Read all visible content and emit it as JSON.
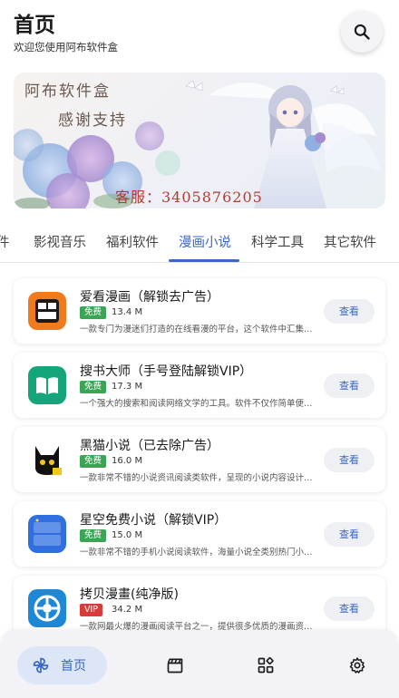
{
  "header": {
    "title": "首页",
    "subtitle": "欢迎您使用阿布软件盒",
    "search_icon": "search-icon"
  },
  "banner": {
    "line1": "阿布软件盒",
    "line2": "感谢支持",
    "line3": "客服：3405876205"
  },
  "tabs": [
    {
      "label": "件"
    },
    {
      "label": "影视音乐"
    },
    {
      "label": "福利软件"
    },
    {
      "label": "漫画小说",
      "active": true
    },
    {
      "label": "科学工具"
    },
    {
      "label": "其它软件"
    }
  ],
  "apps": [
    {
      "name": "爱看漫画（解锁去广告）",
      "badge": "免费",
      "size": "13.4 M",
      "desc": "一款专门为漫迷们打造的在线看漫的平台，这个软件中汇集…",
      "button": "查看",
      "icon": "comic-app-icon"
    },
    {
      "name": "搜书大师（手号登陆解锁VIP）",
      "badge": "免费",
      "size": "17.3 M",
      "desc": "一个强大的搜索和阅读网络文学的工具。软件不仅作简单便…",
      "button": "查看",
      "icon": "book-app-icon"
    },
    {
      "name": "黑猫小说（已去除广告）",
      "badge": "免费",
      "size": "16.0 M",
      "desc": "一款非常不错的小说资讯阅读类软件，呈现的小说内容设计…",
      "button": "查看",
      "icon": "black-cat-app-icon"
    },
    {
      "name": "星空免费小说（解锁VIP）",
      "badge": "免费",
      "size": "15.0 M",
      "desc": "一款非常不错的手机小说阅读软件，海量小说全类别热门小…",
      "button": "查看",
      "icon": "starry-novel-app-icon"
    },
    {
      "name": "拷贝漫畫(纯净版)",
      "badge": "VIP",
      "size": "34.2 M",
      "desc": "一款网最火爆的漫画阅读平台之一，提供很多优质的漫画资…",
      "button": "查看",
      "icon": "copy-manga-app-icon"
    }
  ],
  "bottom_nav": {
    "home_label": "首页"
  },
  "colors": {
    "accent": "#3a68c6",
    "free_badge": "#3aa655",
    "vip_badge": "#d93a3a"
  }
}
